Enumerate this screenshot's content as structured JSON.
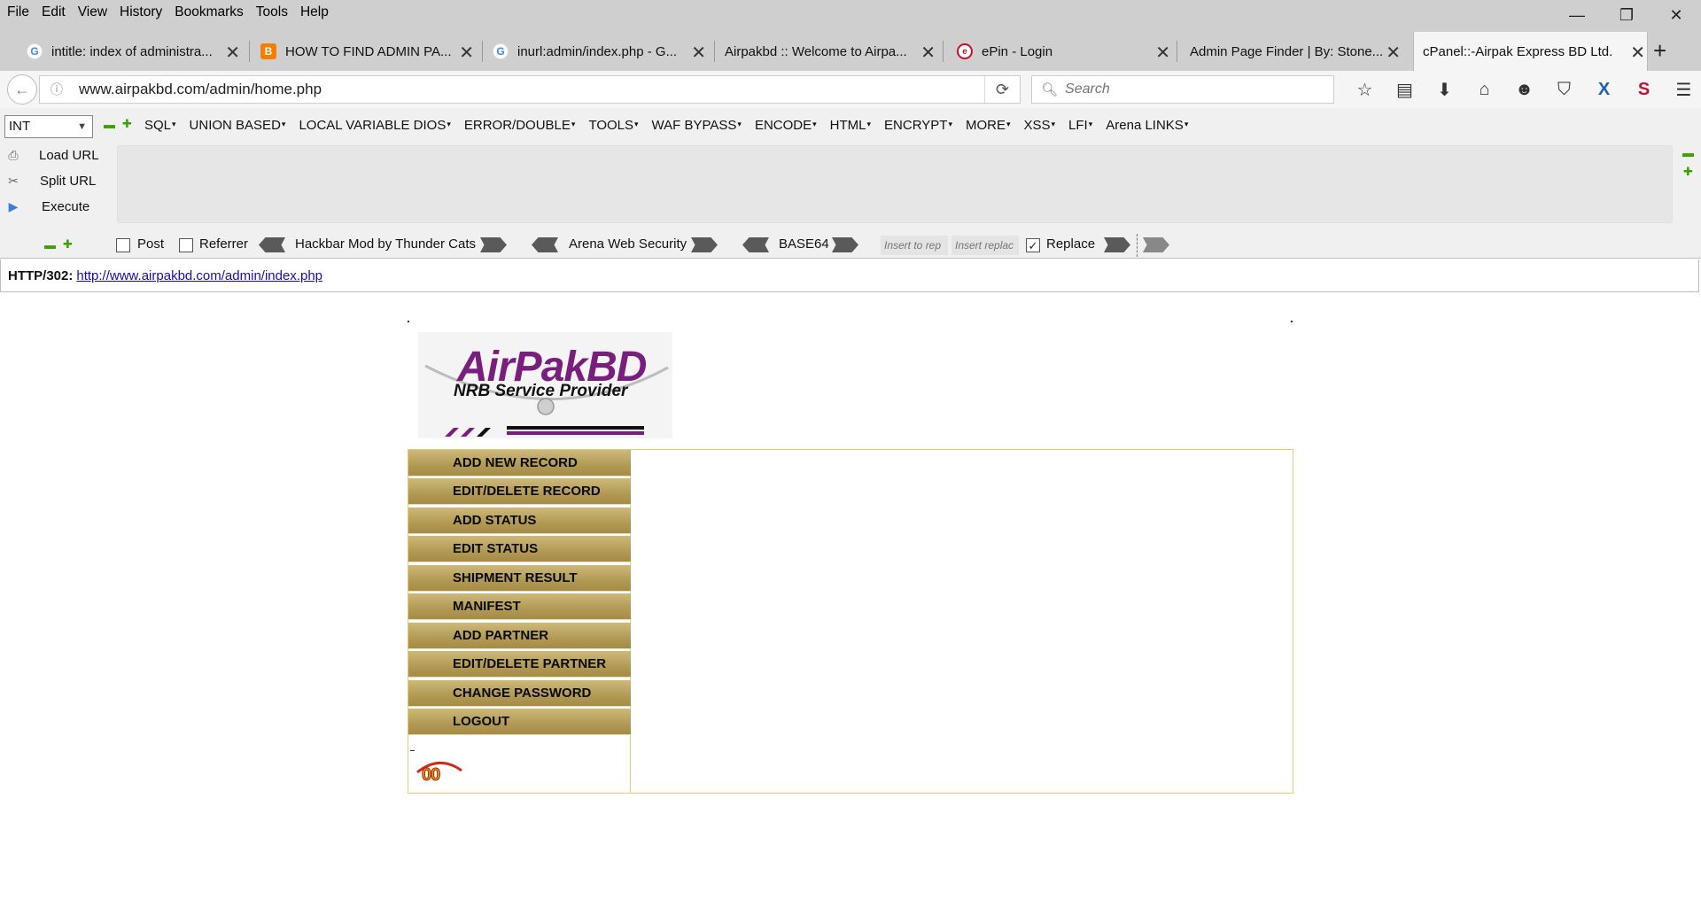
{
  "menubar": [
    "File",
    "Edit",
    "View",
    "History",
    "Bookmarks",
    "Tools",
    "Help"
  ],
  "window_controls": {
    "minimize": "—",
    "restore": "❐",
    "close": "✕"
  },
  "tabs": [
    {
      "title": "intitle: index of administra...",
      "icon": "google-icon"
    },
    {
      "title": "HOW TO FIND ADMIN PA...",
      "icon": "blogger-icon"
    },
    {
      "title": "inurl:admin/index.php - G...",
      "icon": "google-icon"
    },
    {
      "title": "Airpakbd :: Welcome to Airpa...",
      "icon": ""
    },
    {
      "title": "ePin - Login",
      "icon": "epin-icon"
    },
    {
      "title": "Admin Page Finder | By: Stone...",
      "icon": ""
    },
    {
      "title": "cPanel::-Airpak Express BD Ltd.",
      "icon": "",
      "active": true
    }
  ],
  "navbar": {
    "url": "www.airpakbd.com/admin/home.php",
    "search_placeholder": "Search"
  },
  "hackbar": {
    "select_value": "INT",
    "menus": [
      "SQL",
      "UNION BASED",
      "LOCAL VARIABLE DIOS",
      "ERROR/DOUBLE",
      "TOOLS",
      "WAF BYPASS",
      "ENCODE",
      "HTML",
      "ENCRYPT",
      "MORE",
      "XSS",
      "LFI",
      "Arena LINKS"
    ],
    "actions": [
      "Load URL",
      "Split URL",
      "Execute"
    ],
    "post_label": "Post",
    "referrer_label": "Referrer",
    "mod_label": "Hackbar Mod by Thunder Cats",
    "security_label": "Arena Web Security",
    "base64_label": "BASE64",
    "insert_rep_placeholder": "Insert to rep",
    "insert_replace_placeholder": "Insert replac",
    "replace_label": "Replace",
    "replace_checked": true
  },
  "status": {
    "code_label": "HTTP/302:",
    "link": "http://www.airpakbd.com/admin/index.php"
  },
  "page": {
    "logo": {
      "brand": "AirPakBD",
      "tagline": "NRB Service Provider"
    },
    "nav": [
      "ADD NEW RECORD",
      "EDIT/DELETE RECORD",
      "ADD STATUS",
      "EDIT STATUS",
      "SHIPMENT RESULT",
      "MANIFEST",
      "ADD PARTNER",
      "EDIT/DELETE PARTNER",
      "CHANGE PASSWORD",
      "LOGOUT"
    ],
    "counter_value": "00"
  },
  "colors": {
    "nav_button": "#b19a55",
    "panel_border": "#e8c97c",
    "logo_purple": "#7a1e7e",
    "link": "#1a0dab"
  }
}
